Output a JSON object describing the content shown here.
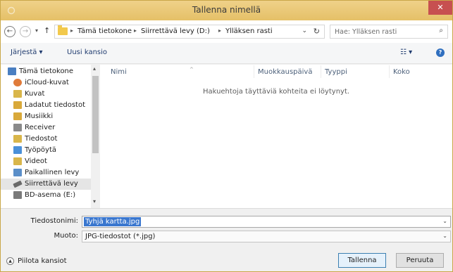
{
  "window": {
    "title": "Tallenna nimellä",
    "close_label": "✕"
  },
  "address": {
    "crumbs": [
      "Tämä tietokone",
      "Siirrettävä levy (D:)",
      "Ylläksen rasti"
    ],
    "search_placeholder": "Hae: Ylläksen rasti"
  },
  "toolbar": {
    "organize_label": "Järjestä ▾",
    "new_folder_label": "Uusi kansio"
  },
  "nav": {
    "items": [
      {
        "label": "Tämä tietokone",
        "icon": "computer-icon",
        "color": "#4a7fc1"
      },
      {
        "label": "iCloud-kuvat",
        "icon": "icloud-icon",
        "color": "#e07b3a"
      },
      {
        "label": "Kuvat",
        "icon": "pictures-folder-icon",
        "color": "#d9b64a"
      },
      {
        "label": "Ladatut tiedostot",
        "icon": "downloads-folder-icon",
        "color": "#d9a93a"
      },
      {
        "label": "Musiikki",
        "icon": "music-folder-icon",
        "color": "#d9a93a"
      },
      {
        "label": "Receiver",
        "icon": "receiver-icon",
        "color": "#8a8a8a"
      },
      {
        "label": "Tiedostot",
        "icon": "documents-folder-icon",
        "color": "#d9b64a"
      },
      {
        "label": "Työpöytä",
        "icon": "desktop-folder-icon",
        "color": "#4a90d9"
      },
      {
        "label": "Videot",
        "icon": "videos-folder-icon",
        "color": "#d9b64a"
      },
      {
        "label": "Paikallinen levy",
        "icon": "local-disk-icon",
        "color": "#5b8fc9"
      },
      {
        "label": "Siirrettävä levy",
        "icon": "removable-drive-icon",
        "color": "#6a6a6a"
      },
      {
        "label": "BD-asema (E:)",
        "icon": "bd-drive-icon",
        "color": "#7a7a7a"
      }
    ],
    "selected_index": 10
  },
  "filelist": {
    "columns": [
      "Nimi",
      "Muokkauspäivä",
      "Tyyppi",
      "Koko"
    ],
    "empty_message": "Hakuehtoja täyttäviä kohteita ei löytynyt."
  },
  "form": {
    "filename_label": "Tiedostonimi:",
    "filename_value": "Tyhjä kartta.jpg",
    "filetype_label": "Muoto:",
    "filetype_value": "JPG-tiedostot (*.jpg)"
  },
  "footer": {
    "hide_folders_label": "Piilota kansiot",
    "save_label": "Tallenna",
    "cancel_label": "Peruuta"
  }
}
